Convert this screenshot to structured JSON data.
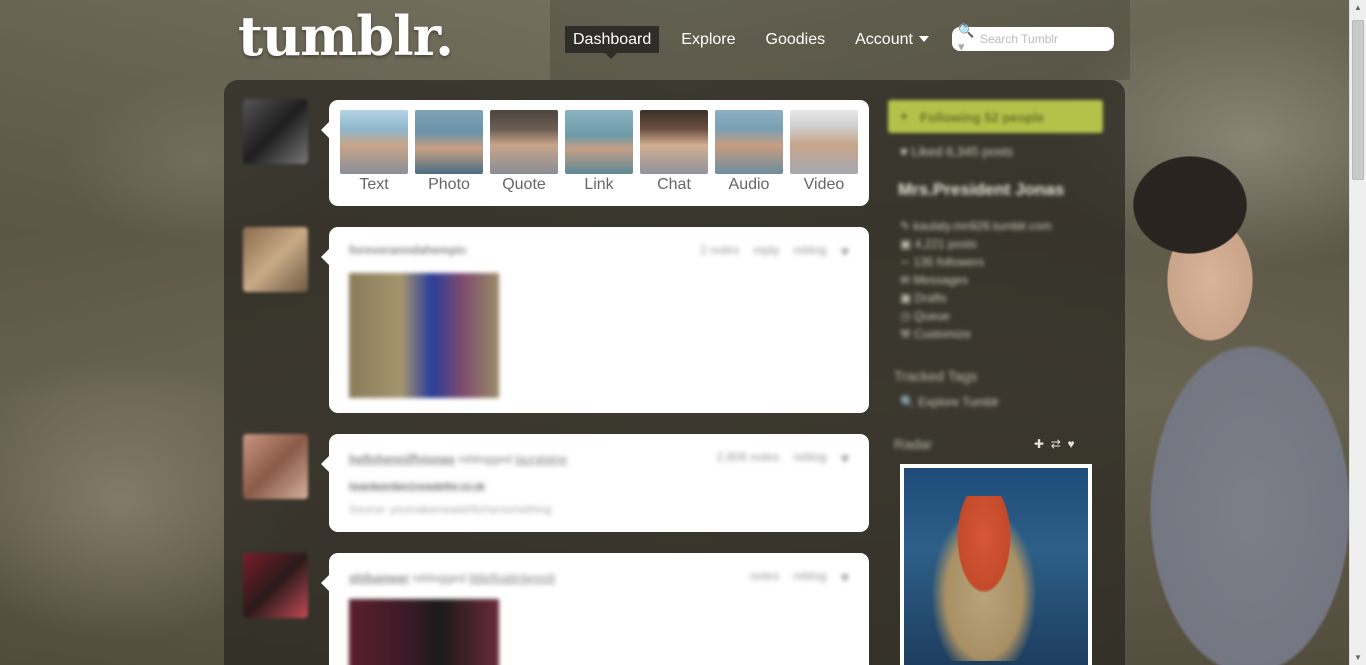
{
  "logo": "tumblr.",
  "nav": {
    "items": [
      {
        "label": "Dashboard",
        "active": true
      },
      {
        "label": "Explore"
      },
      {
        "label": "Goodies"
      },
      {
        "label": "Account"
      }
    ]
  },
  "search": {
    "placeholder": "Search Tumblr"
  },
  "post_types": [
    {
      "label": "Text"
    },
    {
      "label": "Photo"
    },
    {
      "label": "Quote"
    },
    {
      "label": "Link"
    },
    {
      "label": "Chat"
    },
    {
      "label": "Audio"
    },
    {
      "label": "Video"
    }
  ],
  "posts": [
    {
      "author": "foreveranndahempic",
      "notes": "2 notes",
      "reply": "reply",
      "reblog": "reblog"
    },
    {
      "author": "hellohenniffyjonas",
      "reblogged": "reblogged",
      "source_author": "lauralaine",
      "notes": "2,808 notes",
      "reblog": "reblog",
      "body": "heardwordies1nowdethe.co.ok",
      "source": "Source: youmakemewishforhersomething"
    },
    {
      "author": "shilueneer",
      "reblogged": "reblogged",
      "source_author": "littlefloatinteresti",
      "notes": "notes",
      "reblog": "reblog"
    }
  ],
  "sidebar": {
    "following": "Following 52 people",
    "liked": "Liked 6,345 posts",
    "blog_title": "Mrs.President Jonas",
    "links": [
      "kaulaly.mn926.tumblr.com",
      "4,221 posts",
      "135 followers",
      "Messages",
      "Drafts",
      "Queue",
      "Customize"
    ],
    "tracked_tags_title": "Tracked Tags",
    "explore_link": "Explore Tumblr",
    "radar_title": "Radar"
  }
}
